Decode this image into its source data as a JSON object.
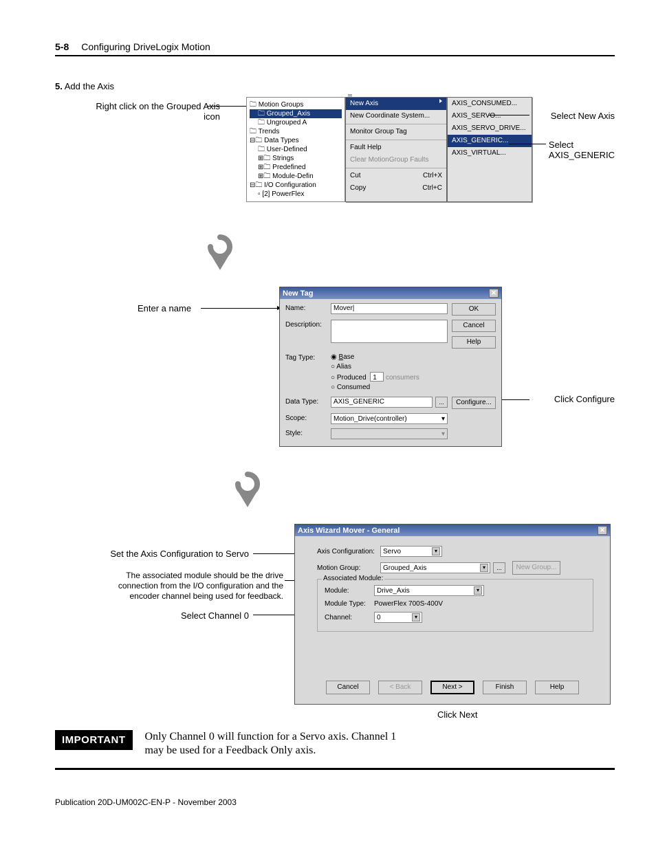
{
  "header": {
    "page_num": "5-8",
    "chapter": "Configuring DriveLogix Motion"
  },
  "step": {
    "num": "5.",
    "text": "Add the Axis"
  },
  "fig1": {
    "ann_left_l1": "Right click on the Grouped Axis",
    "ann_left_l2": "icon",
    "ann_right1": "Select New Axis",
    "ann_right2_l1": "Select",
    "ann_right2_l2": "AXIS_GENERIC",
    "tree": {
      "t1": "Motion Groups",
      "t2": "Grouped_Axis",
      "t3": "Ungrouped A",
      "t4": "Trends",
      "t5": "Data Types",
      "t6": "User-Defined",
      "t7": "Strings",
      "t8": "Predefined",
      "t9": "Module-Defin",
      "t10": "I/O Configuration",
      "t11": "[2] PowerFlex"
    },
    "menu": {
      "m1": "New Axis",
      "m2": "New Coordinate System...",
      "m3": "Monitor Group Tag",
      "m4": "Fault Help",
      "m5": "Clear MotionGroup Faults",
      "m6": "Cut",
      "m6s": "Ctrl+X",
      "m7": "Copy",
      "m7s": "Ctrl+C"
    },
    "sub": {
      "s1": "AXIS_CONSUMED...",
      "s2": "AXIS_SERVO...",
      "s3": "AXIS_SERVO_DRIVE...",
      "s4": "AXIS_GENERIC...",
      "s5": "AXIS_VIRTUAL..."
    }
  },
  "fig2": {
    "title": "New Tag",
    "name_lbl": "Name:",
    "name_val": "Mover|",
    "desc_lbl": "Description:",
    "tagtype_lbl": "Tag Type:",
    "r_base": "Base",
    "r_alias": "Alias",
    "r_prod": "Produced",
    "r_prod_num": "1",
    "r_prod_txt": "consumers",
    "r_cons": "Consumed",
    "dtype_lbl": "Data Type:",
    "dtype_val": "AXIS_GENERIC",
    "scope_lbl": "Scope:",
    "scope_val": "Motion_Drive(controller)",
    "style_lbl": "Style:",
    "btn_ok": "OK",
    "btn_cancel": "Cancel",
    "btn_help": "Help",
    "btn_conf": "Configure...",
    "btn_dots": "...",
    "ann_a": "Enter a name",
    "ann_b": "Click Configure"
  },
  "fig3": {
    "title": "Axis Wizard Mover - General",
    "ac_lbl": "Axis Configuration:",
    "ac_val": "Servo",
    "mg_lbl": "Motion Group:",
    "mg_val": "Grouped_Axis",
    "newgrp": "New Group...",
    "legend": "Associated Module:",
    "mod_lbl": "Module:",
    "mod_val": "Drive_Axis",
    "mt_lbl": "Module Type:",
    "mt_val": "PowerFlex 700S-400V",
    "ch_lbl": "Channel:",
    "ch_val": "0",
    "cancel": "Cancel",
    "back": "< Back",
    "next": "Next >",
    "finish": "Finish",
    "help": "Help",
    "ann_a": "Set the Axis Configuration to Servo",
    "ann_b1": "The associated module should be the drive",
    "ann_b2": "connection from the I/O configuration and the",
    "ann_b3": "encoder channel being used for feedback.",
    "ann_c": "Select Channel 0",
    "ann_d": "Click Next"
  },
  "important": {
    "tag": "IMPORTANT",
    "text": "Only Channel 0 will function for a Servo axis. Channel 1 may be used for a Feedback Only axis."
  },
  "pub": "Publication 20D-UM002C-EN-P - November 2003"
}
